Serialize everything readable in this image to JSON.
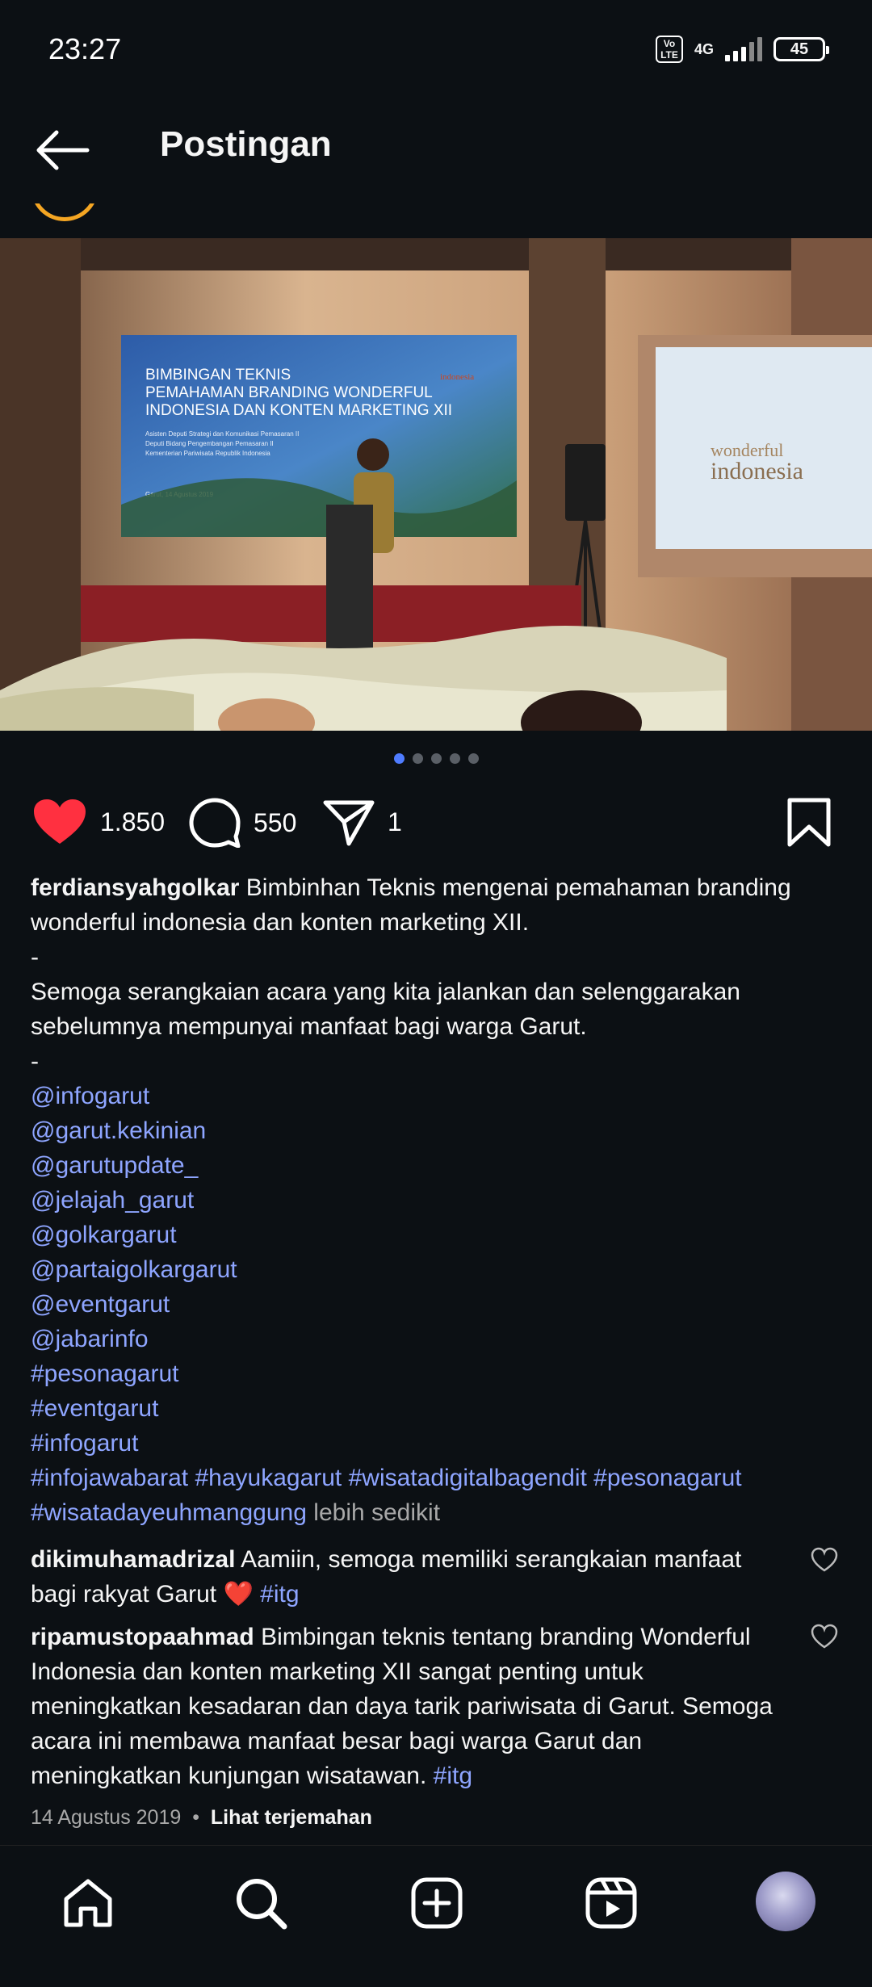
{
  "status_bar": {
    "time": "23:27",
    "volte": "Vo LTE",
    "network": "4G",
    "battery": "45"
  },
  "header": {
    "title": "Postingan",
    "back_icon": "back-arrow-icon"
  },
  "photo": {
    "banner_line1": "BIMBINGAN TEKNIS",
    "banner_line2": "PEMAHAMAN BRANDING WONDERFUL",
    "banner_line3": "INDONESIA DAN KONTEN MARKETING XII",
    "banner_sub1": "Asisten Deputi Strategi dan Komunikasi Pemasaran II",
    "banner_sub2": "Deputi Bidang Pengembangan Pemasaran II",
    "banner_sub3": "Kementerian Pariwisata Republik Indonesia",
    "banner_date": "Garut, 14 Agustus 2019",
    "banner_logo": "indonesia",
    "screen_line1": "wonderful",
    "screen_line2": "indonesia"
  },
  "carousel": {
    "count": 5,
    "active": 0
  },
  "actions": {
    "likes": "1.850",
    "comments": "550",
    "shares": "1"
  },
  "caption": {
    "username": "ferdiansyahgolkar",
    "text1": "Bimbinhan Teknis mengenai pemahaman branding wonderful indonesia dan konten marketing XII.",
    "sep1": "-",
    "text2": "Semoga serangkaian acara yang kita jalankan dan selenggarakan sebelumnya mempunyai manfaat bagi warga Garut.",
    "sep2": "-",
    "tags": [
      "@infogarut",
      "@garut.kekinian",
      "@garutupdate_",
      "@jelajah_garut",
      "@golkargarut",
      "@partaigolkargarut",
      "@eventgarut",
      "@jabarinfo",
      "#pesonagarut",
      "#eventgarut",
      "#infogarut"
    ],
    "tagline1": "#infojawabarat #hayukagarut #wisatadigitalbagendit #pesonagarut",
    "tagline2": "#wisatadayeuhmanggung",
    "less": "lebih sedikit"
  },
  "comments": [
    {
      "username": "dikimuhamadrizal",
      "text": "Aamiin, semoga memiliki serangkaian manfaat bagi rakyat Garut",
      "emoji": "❤️",
      "tag": "#itg"
    },
    {
      "username": "ripamustopaahmad",
      "text": "Bimbingan teknis tentang branding Wonderful Indonesia dan konten marketing XII sangat penting untuk meningkatkan kesadaran dan daya tarik pariwisata di Garut. Semoga acara ini membawa manfaat besar bagi warga Garut dan meningkatkan kunjungan wisatawan.",
      "tag": "#itg"
    }
  ],
  "meta": {
    "date": "14 Agustus 2019",
    "dot": "•",
    "translate": "Lihat terjemahan"
  },
  "colors": {
    "background": "#0c1014",
    "link": "#8ea5ff",
    "like": "#ff3040",
    "carousel_active": "#4f7cff"
  },
  "nav": [
    "home-icon",
    "search-icon",
    "create-post-icon",
    "reels-icon",
    "profile-avatar"
  ]
}
